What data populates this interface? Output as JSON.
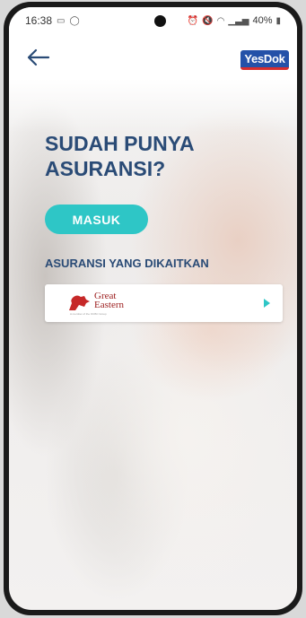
{
  "status": {
    "time": "16:38",
    "battery": "40%"
  },
  "appbar": {
    "logo": "YesDok"
  },
  "headline": {
    "line1": "SUDAH PUNYA",
    "line2": "ASURANSI?"
  },
  "buttons": {
    "login": "MASUK"
  },
  "section": {
    "title": "ASURANSI YANG DIKAITKAN"
  },
  "insurers": [
    {
      "name_line1": "Great",
      "name_line2": "Eastern",
      "tagline": "A member of the OCBC Group"
    }
  ],
  "colors": {
    "accent": "#2ec6c6",
    "heading": "#2a4b76",
    "brand": "#2451a8"
  }
}
